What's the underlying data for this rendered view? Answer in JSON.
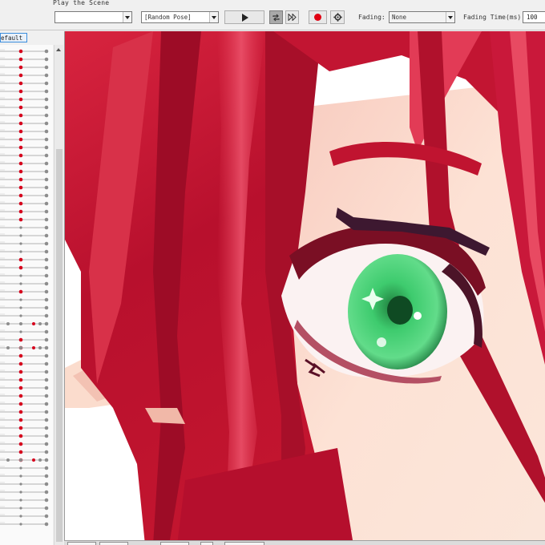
{
  "toolbar": {
    "section_label": "Play the Scene",
    "scene_select": {
      "value": ""
    },
    "pose_select": {
      "value": "[Random Pose]"
    },
    "fading_label": "Fading:",
    "fading_select": {
      "value": "None"
    },
    "fading_time_label": "Fading Time(ms):",
    "fading_time_value": "100",
    "record_color": "#e00012"
  },
  "left_panel": {
    "model_tab_label": "efault",
    "slider_knob_color": "#d6001c",
    "slider_rows": 60
  },
  "canvas": {
    "content": "character-portrait",
    "hair_color": "#c41230",
    "eye_color": "#3ecb6e",
    "skin_color": "#fce0d2"
  }
}
